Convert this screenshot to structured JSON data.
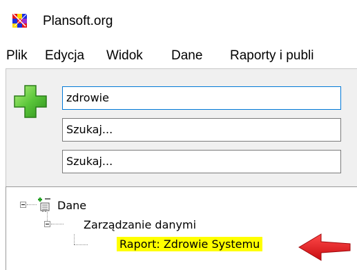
{
  "window": {
    "title": "Plansoft.org",
    "icon": "plansoft-app-icon"
  },
  "menu": {
    "items": [
      "Plik",
      "Edycja",
      "Widok",
      "Dane",
      "Raporty i publi"
    ]
  },
  "search": {
    "add_icon": "green-plus-icon",
    "field1_value": "zdrowie",
    "field2_value": "Szukaj...",
    "field3_value": "Szukaj..."
  },
  "tree": {
    "root_label": "Dane",
    "root_icon": "data-tree-icon",
    "child_label": "Zarządzanie danymi",
    "leaf_label": "Raport: Zdrowie Systemu",
    "highlight_color": "#ffff00",
    "pointer_icon": "red-arrow-icon",
    "pointer_color": "#e8161a"
  }
}
